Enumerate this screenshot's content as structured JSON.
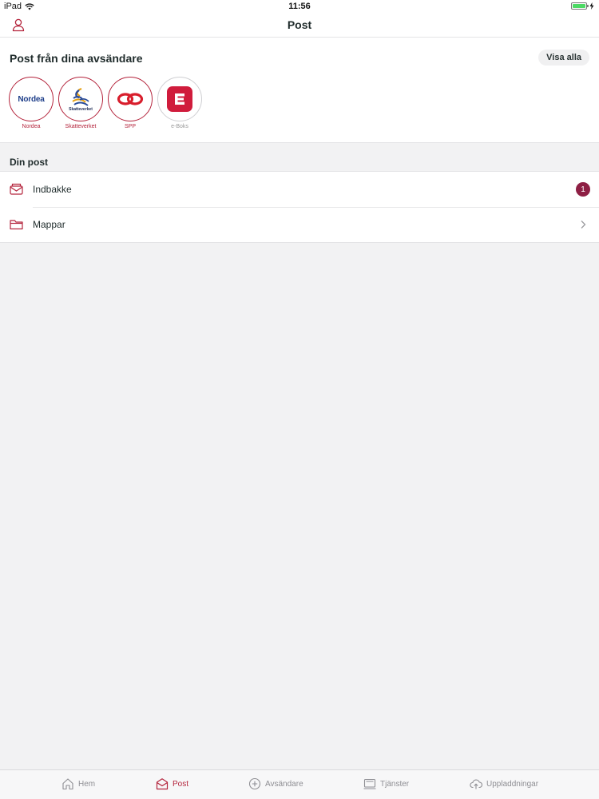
{
  "status_bar": {
    "device": "iPad",
    "time": "11:56"
  },
  "nav": {
    "title": "Post"
  },
  "senders": {
    "title": "Post från dina avsändare",
    "show_all_label": "Visa alla",
    "items": [
      {
        "name": "Nordea",
        "logo_text": "Nordea"
      },
      {
        "name": "Skatteverket",
        "logo_text": "Skatteverket"
      },
      {
        "name": "SPP"
      },
      {
        "name": "e-Boks"
      }
    ]
  },
  "post": {
    "heading": "Din post",
    "rows": [
      {
        "label": "Indbakke",
        "badge": "1"
      },
      {
        "label": "Mappar"
      }
    ]
  },
  "tabs": [
    {
      "label": "Hem",
      "icon": "home-icon"
    },
    {
      "label": "Post",
      "icon": "mail-icon",
      "active": true
    },
    {
      "label": "Avsändare",
      "icon": "plus-circle-icon"
    },
    {
      "label": "Tjänster",
      "icon": "services-icon"
    },
    {
      "label": "Uppladdningar",
      "icon": "cloud-upload-icon"
    }
  ],
  "colors": {
    "accent": "#b4243c",
    "badge": "#8e1f44",
    "background": "#f2f2f3"
  }
}
